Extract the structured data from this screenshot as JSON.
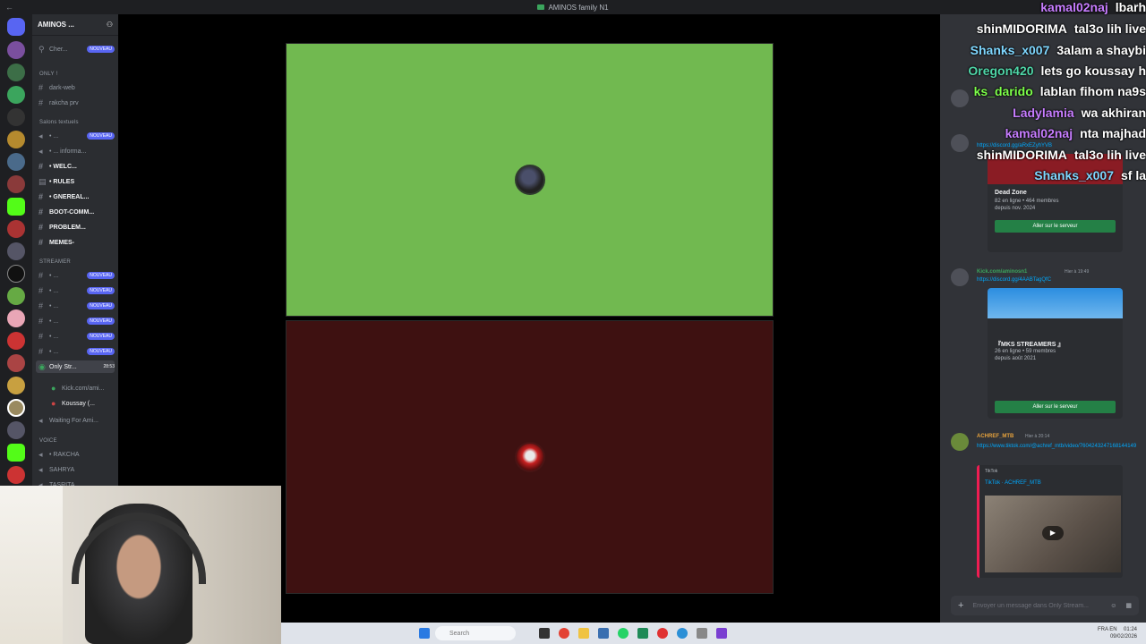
{
  "window": {
    "title": "AMINOS family N1"
  },
  "server": {
    "name": "AMINOS ..."
  },
  "channels": [
    {
      "label": "Cher...",
      "badge": "NOUVEAU"
    },
    {
      "category": "ONLY !"
    },
    {
      "label": "dark-web"
    },
    {
      "label": "rakcha prv"
    },
    {
      "category": "Salons textuels"
    },
    {
      "label": "• ...",
      "badge": "NOUVEAU"
    },
    {
      "label": "• ... informa..."
    },
    {
      "label": "• WELC..."
    },
    {
      "label": "• RULES"
    },
    {
      "label": "• GNEREAL..."
    },
    {
      "label": "BOOT-COMM..."
    },
    {
      "label": "PROBLEM..."
    },
    {
      "label": "MEMES-"
    },
    {
      "category": "STREAMER"
    },
    {
      "label": "• ...",
      "badge": "NOUVEAU"
    },
    {
      "label": "• ...",
      "badge": "NOUVEAU"
    },
    {
      "label": "• ...",
      "badge": "NOUVEAU"
    },
    {
      "label": "• ...",
      "badge": "NOUVEAU"
    },
    {
      "label": "• ...",
      "badge": "NOUVEAU"
    },
    {
      "label": "• ...",
      "badge": "NOUVEAU"
    },
    {
      "label": "Only Str...",
      "time": "28:53"
    },
    {
      "label": "Kick.com/ami..."
    },
    {
      "label": "Koussay (..."
    },
    {
      "label": "Waiting For Ami..."
    },
    {
      "category": "VOICE"
    },
    {
      "label": "• RAKCHA"
    },
    {
      "label": "SAHRYA"
    },
    {
      "label": "TASRITA"
    }
  ],
  "chat_overlay": [
    {
      "user": "kamal02naj",
      "color": "#c77dff",
      "text": "lbarh"
    },
    {
      "user": "shinMIDORIMA",
      "color": "#ffffff",
      "text": "tal3o lih live"
    },
    {
      "user": "Shanks_x007",
      "color": "#7fd7ff",
      "text": "3alam a shaybi"
    },
    {
      "user": "Oregon420",
      "color": "#4fd6a8",
      "text": "lets go koussay h"
    },
    {
      "user": "ks_darido",
      "color": "#7dff4a",
      "text": "lablan fihom na9s"
    },
    {
      "user": "Ladylamia",
      "color": "#c77dff",
      "text": "wa akhiran"
    },
    {
      "user": "kamal02naj",
      "color": "#c77dff",
      "text": "nta majhad"
    },
    {
      "user": "shinMIDORIMA",
      "color": "#ffffff",
      "text": "tal3o lih live"
    },
    {
      "user": "Shanks_x007",
      "color": "#7fd7ff",
      "text": "sf la"
    }
  ],
  "discord_messages": {
    "m1": {
      "link": "https://discord.gg/aRxEZyhYVB",
      "server_name": "Dead Zone",
      "stats": "82 en ligne • 464 membres",
      "since": "depuis nov. 2024",
      "button": "Aller sur le serveur"
    },
    "m2": {
      "user": "Kick.com/aminosn1",
      "time": "Hier à 19:49",
      "link": "https://discord.gg/4AABTagQfC",
      "server_name": "『MKS STREAMERS 』",
      "stats": "26 en ligne • 59 membres",
      "since": "depuis août 2021",
      "button": "Aller sur le serveur"
    },
    "m3": {
      "user": "ACHREF_MTB",
      "time": "Hier à 20:14",
      "link": "https://www.tiktok.com/@achref_mtb/video/7604243247168144149",
      "embed_site": "TikTok",
      "embed_title": "TikTok · ACHREF_MTB"
    }
  },
  "composer": {
    "placeholder": "Envoyer un message dans Only Stream..."
  },
  "taskbar": {
    "search": "Search",
    "lang": "FRA",
    "region": "EN",
    "time": "01:24",
    "date": "09/02/2026"
  }
}
